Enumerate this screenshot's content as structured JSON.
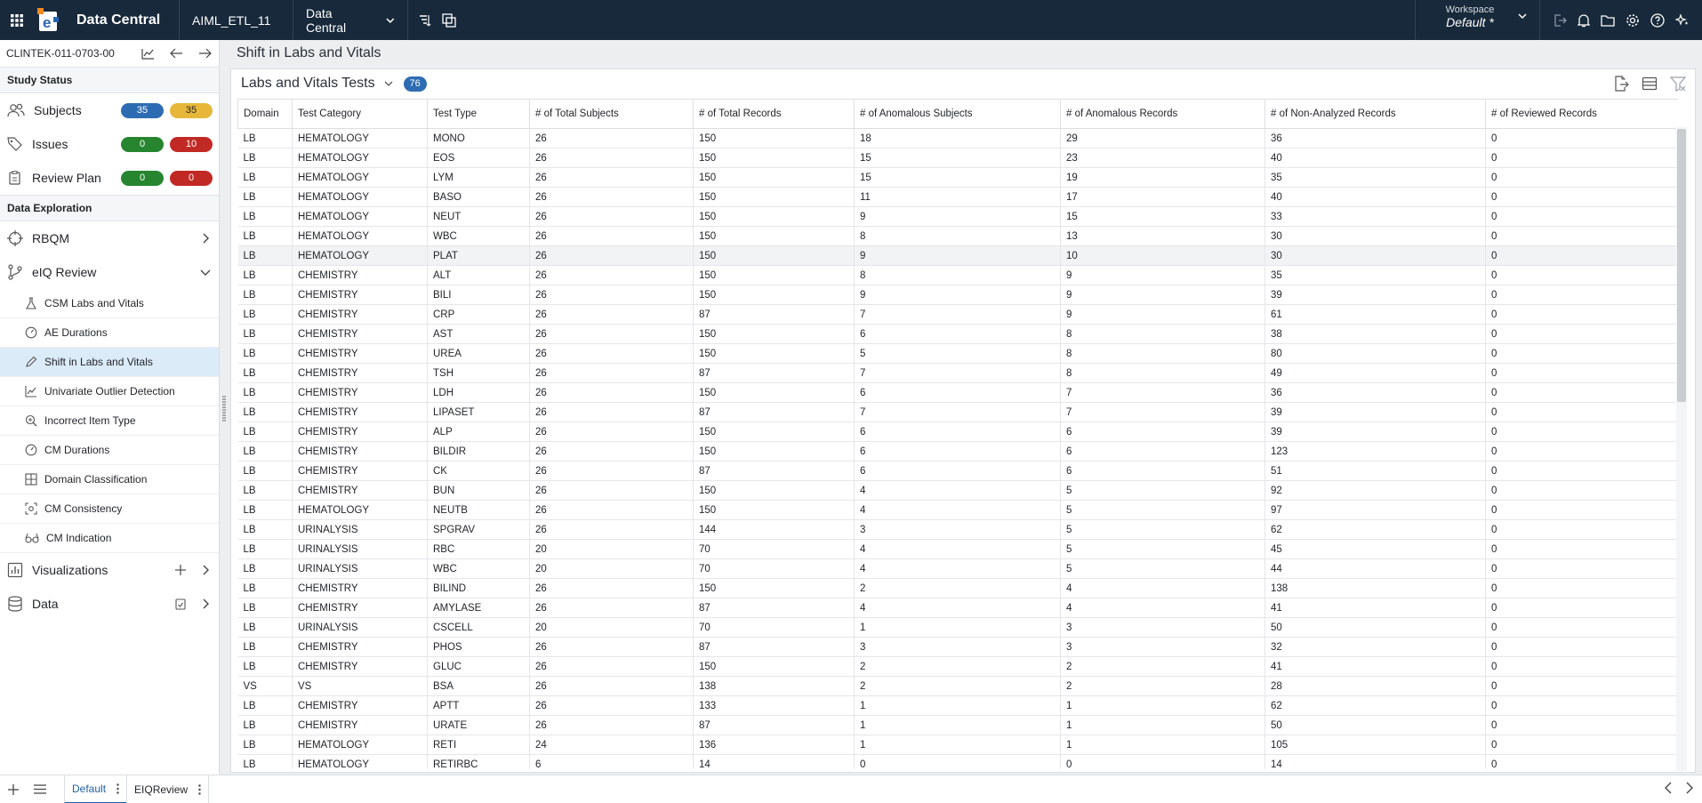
{
  "topbar": {
    "app_title": "Data Central",
    "selector_1": "AIML_ETL_11",
    "selector_2": "Data Central",
    "workspace_label": "Workspace",
    "workspace_value": "Default",
    "workspace_marker": "*"
  },
  "sidebar": {
    "study_id": "CLINTEK-011-0703-00",
    "study_status_heading": "Study Status",
    "subjects": {
      "label": "Subjects",
      "badge_a": "35",
      "badge_b": "35"
    },
    "issues": {
      "label": "Issues",
      "badge_a": "0",
      "badge_b": "10"
    },
    "review_plan": {
      "label": "Review Plan",
      "badge_a": "0",
      "badge_b": "0"
    },
    "data_exploration_heading": "Data Exploration",
    "rbqm": "RBQM",
    "eiq_review": "eIQ Review",
    "sub_items": [
      {
        "label": "CSM Labs and Vitals",
        "icon": "flask-icon"
      },
      {
        "label": "AE Durations",
        "icon": "clock-icon"
      },
      {
        "label": "Shift in Labs and Vitals",
        "icon": "pencil-icon"
      },
      {
        "label": "Univariate Outlier Detection",
        "icon": "line-chart-icon"
      },
      {
        "label": "Incorrect Item Type",
        "icon": "magnify-icon"
      },
      {
        "label": "CM Durations",
        "icon": "clock-icon"
      },
      {
        "label": "Domain Classification",
        "icon": "grid-icon"
      },
      {
        "label": "CM Consistency",
        "icon": "focus-icon"
      },
      {
        "label": "CM Indication",
        "icon": "glasses-icon"
      }
    ],
    "visualizations": "Visualizations",
    "data": "Data"
  },
  "main": {
    "page_title": "Shift in Labs and Vitals",
    "panel_title": "Labs and Vitals Tests",
    "panel_count": "76"
  },
  "table": {
    "headers": [
      "Domain",
      "Test Category",
      "Test Type",
      "# of Total Subjects",
      "# of Total Records",
      "# of Anomalous Subjects",
      "# of Anomalous Records",
      "# of Non-Analyzed Records",
      "# of Reviewed Records"
    ],
    "rows": [
      [
        "LB",
        "HEMATOLOGY",
        "MONO",
        "26",
        "150",
        "18",
        "29",
        "36",
        "0"
      ],
      [
        "LB",
        "HEMATOLOGY",
        "EOS",
        "26",
        "150",
        "15",
        "23",
        "40",
        "0"
      ],
      [
        "LB",
        "HEMATOLOGY",
        "LYM",
        "26",
        "150",
        "15",
        "19",
        "35",
        "0"
      ],
      [
        "LB",
        "HEMATOLOGY",
        "BASO",
        "26",
        "150",
        "11",
        "17",
        "40",
        "0"
      ],
      [
        "LB",
        "HEMATOLOGY",
        "NEUT",
        "26",
        "150",
        "9",
        "15",
        "33",
        "0"
      ],
      [
        "LB",
        "HEMATOLOGY",
        "WBC",
        "26",
        "150",
        "8",
        "13",
        "30",
        "0"
      ],
      [
        "LB",
        "HEMATOLOGY",
        "PLAT",
        "26",
        "150",
        "9",
        "10",
        "30",
        "0"
      ],
      [
        "LB",
        "CHEMISTRY",
        "ALT",
        "26",
        "150",
        "8",
        "9",
        "35",
        "0"
      ],
      [
        "LB",
        "CHEMISTRY",
        "BILI",
        "26",
        "150",
        "9",
        "9",
        "39",
        "0"
      ],
      [
        "LB",
        "CHEMISTRY",
        "CRP",
        "26",
        "87",
        "7",
        "9",
        "61",
        "0"
      ],
      [
        "LB",
        "CHEMISTRY",
        "AST",
        "26",
        "150",
        "6",
        "8",
        "38",
        "0"
      ],
      [
        "LB",
        "CHEMISTRY",
        "UREA",
        "26",
        "150",
        "5",
        "8",
        "80",
        "0"
      ],
      [
        "LB",
        "CHEMISTRY",
        "TSH",
        "26",
        "87",
        "7",
        "8",
        "49",
        "0"
      ],
      [
        "LB",
        "CHEMISTRY",
        "LDH",
        "26",
        "150",
        "6",
        "7",
        "36",
        "0"
      ],
      [
        "LB",
        "CHEMISTRY",
        "LIPASET",
        "26",
        "87",
        "7",
        "7",
        "39",
        "0"
      ],
      [
        "LB",
        "CHEMISTRY",
        "ALP",
        "26",
        "150",
        "6",
        "6",
        "39",
        "0"
      ],
      [
        "LB",
        "CHEMISTRY",
        "BILDIR",
        "26",
        "150",
        "6",
        "6",
        "123",
        "0"
      ],
      [
        "LB",
        "CHEMISTRY",
        "CK",
        "26",
        "87",
        "6",
        "6",
        "51",
        "0"
      ],
      [
        "LB",
        "CHEMISTRY",
        "BUN",
        "26",
        "150",
        "4",
        "5",
        "92",
        "0"
      ],
      [
        "LB",
        "HEMATOLOGY",
        "NEUTB",
        "26",
        "150",
        "4",
        "5",
        "97",
        "0"
      ],
      [
        "LB",
        "URINALYSIS",
        "SPGRAV",
        "26",
        "144",
        "3",
        "5",
        "62",
        "0"
      ],
      [
        "LB",
        "URINALYSIS",
        "RBC",
        "20",
        "70",
        "4",
        "5",
        "45",
        "0"
      ],
      [
        "LB",
        "URINALYSIS",
        "WBC",
        "20",
        "70",
        "4",
        "5",
        "44",
        "0"
      ],
      [
        "LB",
        "CHEMISTRY",
        "BILIND",
        "26",
        "150",
        "2",
        "4",
        "138",
        "0"
      ],
      [
        "LB",
        "CHEMISTRY",
        "AMYLASE",
        "26",
        "87",
        "4",
        "4",
        "41",
        "0"
      ],
      [
        "LB",
        "URINALYSIS",
        "CSCELL",
        "20",
        "70",
        "1",
        "3",
        "50",
        "0"
      ],
      [
        "LB",
        "CHEMISTRY",
        "PHOS",
        "26",
        "87",
        "3",
        "3",
        "32",
        "0"
      ],
      [
        "LB",
        "CHEMISTRY",
        "GLUC",
        "26",
        "150",
        "2",
        "2",
        "41",
        "0"
      ],
      [
        "VS",
        "VS",
        "BSA",
        "26",
        "138",
        "2",
        "2",
        "28",
        "0"
      ],
      [
        "LB",
        "CHEMISTRY",
        "APTT",
        "26",
        "133",
        "1",
        "1",
        "62",
        "0"
      ],
      [
        "LB",
        "CHEMISTRY",
        "URATE",
        "26",
        "87",
        "1",
        "1",
        "50",
        "0"
      ],
      [
        "LB",
        "HEMATOLOGY",
        "RETI",
        "24",
        "136",
        "1",
        "1",
        "105",
        "0"
      ],
      [
        "LB",
        "HEMATOLOGY",
        "RETIRBC",
        "6",
        "14",
        "0",
        "0",
        "14",
        "0"
      ]
    ]
  },
  "bottombar": {
    "tab_1": "Default",
    "tab_2": "EIQReview"
  }
}
